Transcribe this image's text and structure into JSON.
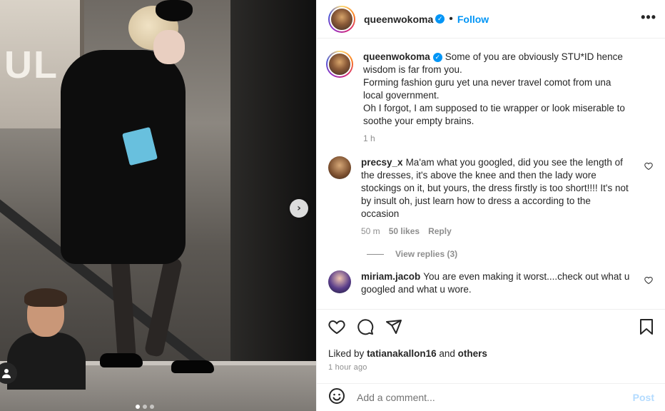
{
  "post": {
    "username": "queenwokoma",
    "separator": "•",
    "follow_label": "Follow",
    "more_label": "•••",
    "next_label": "›"
  },
  "comments": [
    {
      "username": "queenwokoma",
      "text": "Some of you are obviously STU*ID hence wisdom is far from you.\nForming fashion guru yet una never travel comot from una local government.\nOh I forgot, I am supposed to tie wrapper or look miserable to soothe your empty brains.",
      "time": "1 h"
    },
    {
      "username": "precsy_x",
      "text": "Ma'am what you googled, did you see the length of the dresses, it's above the knee and then the lady wore stockings on it, but yours, the dress firstly is too short!!!! It's not by insult oh, just learn how to dress a according to the occasion",
      "time": "50 m",
      "likes": "50 likes",
      "reply": "Reply",
      "view_replies": "View replies (3)"
    },
    {
      "username": "miriam.jacob",
      "text": "You are even making it worst....check out what u googled and what u wore."
    }
  ],
  "likes": {
    "prefix": "Liked by",
    "user": "tatianakallon16",
    "and": "and",
    "others": "others"
  },
  "timestamp": "1 hour ago",
  "composer": {
    "placeholder": "Add a comment...",
    "post_label": "Post"
  },
  "photo_sign": "UL"
}
